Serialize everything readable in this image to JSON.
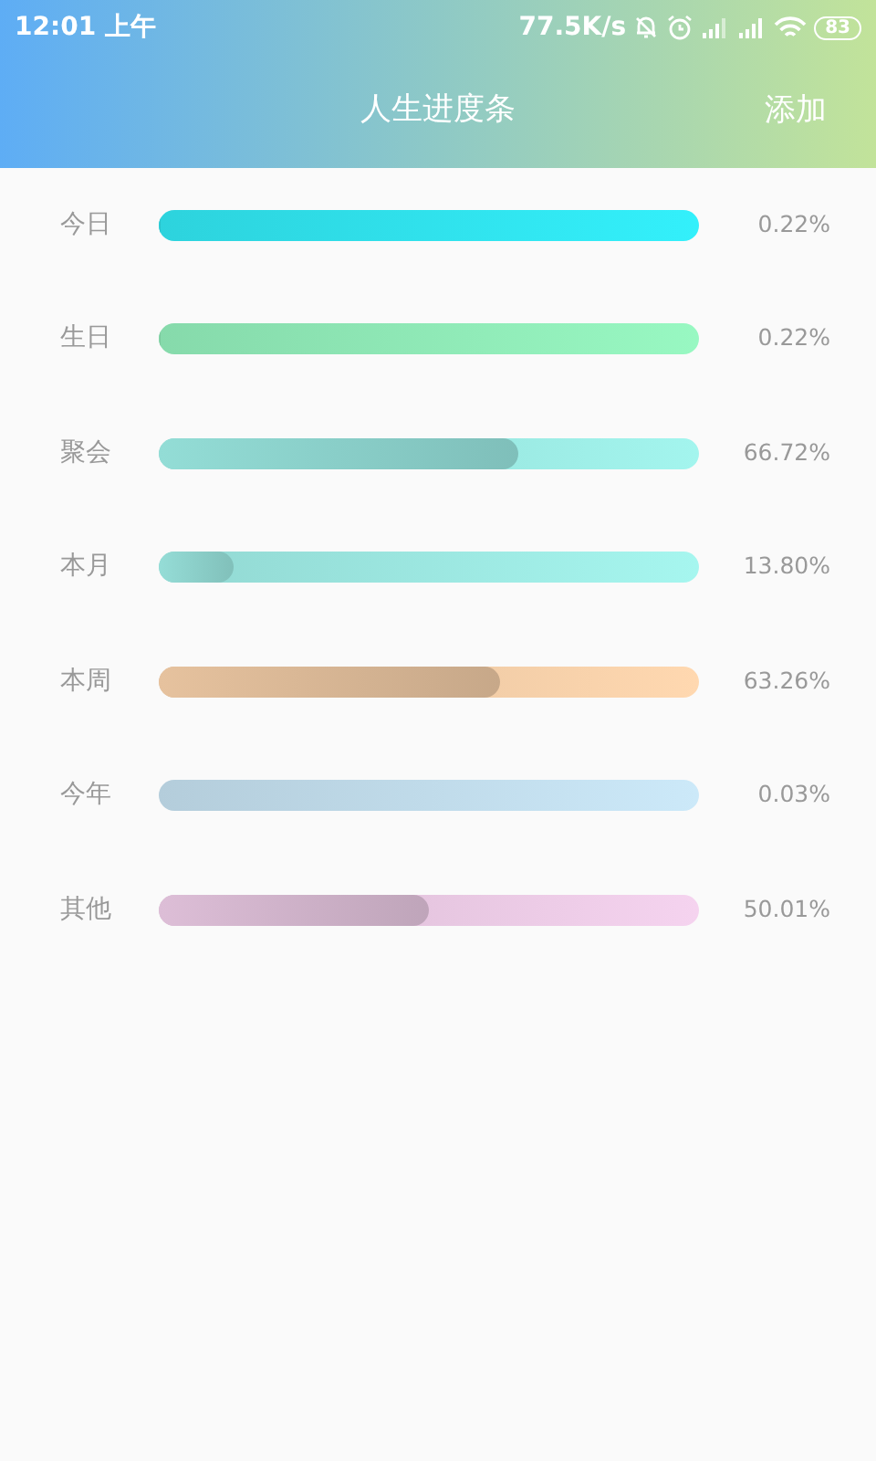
{
  "status_bar": {
    "time": "12:01 上午",
    "speed": "77.5K/s",
    "battery": "83"
  },
  "header": {
    "title": "人生进度条",
    "action": "添加"
  },
  "progress_items": [
    {
      "label": "今日",
      "level": 0.0022,
      "reading": "0.22%",
      "color": "#33f0fb"
    },
    {
      "label": "生日",
      "level": 0.0022,
      "reading": "0.22%",
      "color": "#98f8c2"
    },
    {
      "label": "聚会",
      "level": 0.6672,
      "reading": "66.72%",
      "color": "#a3f5ee"
    },
    {
      "label": "本月",
      "level": 0.138,
      "reading": "13.80%",
      "color": "#a6f6ef"
    },
    {
      "label": "本周",
      "level": 0.6326,
      "reading": "63.26%",
      "color": "#ffd8b0"
    },
    {
      "label": "今年",
      "level": 0.0003,
      "reading": "0.03%",
      "color": "#cce9f9"
    },
    {
      "label": "其他",
      "level": 0.5001,
      "reading": "50.01%",
      "color": "#f5d3ef"
    }
  ]
}
